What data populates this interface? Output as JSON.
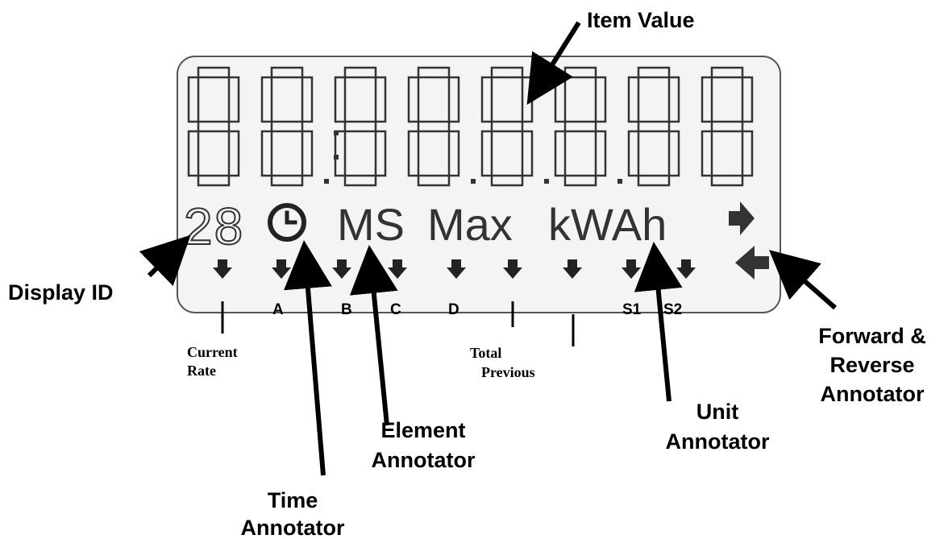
{
  "callouts": {
    "item_value": "Item Value",
    "display_id": "Display ID",
    "forward_reverse": [
      "Forward &",
      "Reverse",
      "Annotator"
    ],
    "element": [
      "Element",
      "Annotator"
    ],
    "unit": [
      "Unit",
      "Annotator"
    ],
    "time": [
      "Time",
      "Annotator"
    ]
  },
  "lcd": {
    "display_id": "28",
    "element_text": "MS",
    "max_text": "Max",
    "unit_text": "kWAh",
    "digit_count": 8
  },
  "markers": {
    "a": "A",
    "b": "B",
    "c": "C",
    "d": "D",
    "s1": "S1",
    "s2": "S2",
    "current_rate": [
      "Current",
      "Rate"
    ],
    "total": "Total",
    "previous": "Previous"
  },
  "colors": {
    "lcd_background": "#f4f4f4",
    "lcd_border": "#555555",
    "segment": "#333333",
    "text": "#000000"
  },
  "icons": {
    "clock": "clock-icon",
    "forward": "forward-arrow-icon",
    "reverse": "reverse-arrow-icon",
    "marker": "down-arrow-icon"
  }
}
